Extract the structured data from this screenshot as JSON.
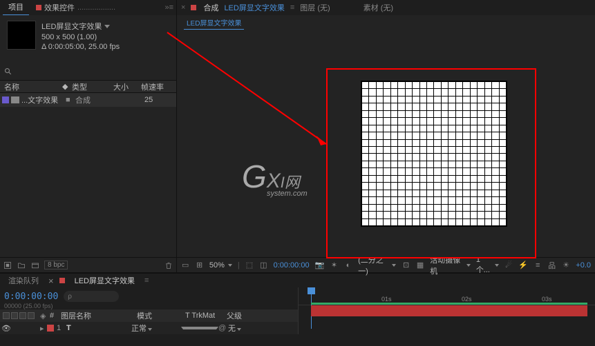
{
  "project_panel": {
    "tab_project": "项目",
    "tab_effects": "效果控件",
    "comp_name": "LED屏显文字效果",
    "comp_dims": "500 x 500 (1.00)",
    "comp_duration": "Δ 0:00:05:00, 25.00 fps",
    "headers": {
      "name": "名称",
      "type": "类型",
      "size": "大小",
      "fps": "帧速率"
    },
    "item": {
      "name": "...文字效果",
      "type": "合成",
      "fps": "25"
    },
    "bpc": "8 bpc"
  },
  "viewer": {
    "tab_composition": "合成",
    "active_comp": "LED屏显文字效果",
    "tab_layer": "图层 (无)",
    "tab_footage": "素材 (无)",
    "subtab": "LED屏显文字效果",
    "zoom": "50%",
    "timecode": "0:00:00:00",
    "res": "(二分之一)",
    "camera": "活动摄像机",
    "views": "1个...",
    "exposure": "+0.0"
  },
  "timeline": {
    "tab_render": "渲染队列",
    "tab_comp": "LED屏显文字效果",
    "current_time": "0:00:00:00",
    "fps_sub": "00000 (25.00 fps)",
    "headers": {
      "num": "#",
      "name": "图层名称",
      "mode": "模式",
      "trkmat": "T  TrkMat",
      "parent": "父级"
    },
    "layer": {
      "num": "1",
      "icon": "T",
      "name": "",
      "mode": "正常",
      "parent": "无",
      "link": "@"
    },
    "ruler": {
      "t1": "01s",
      "t2": "02s",
      "t3": "03s"
    }
  },
  "watermark": {
    "line1a": "G",
    "line1b": "X",
    "line1c": "I",
    "line1d": "网",
    "line2": "system.com"
  }
}
